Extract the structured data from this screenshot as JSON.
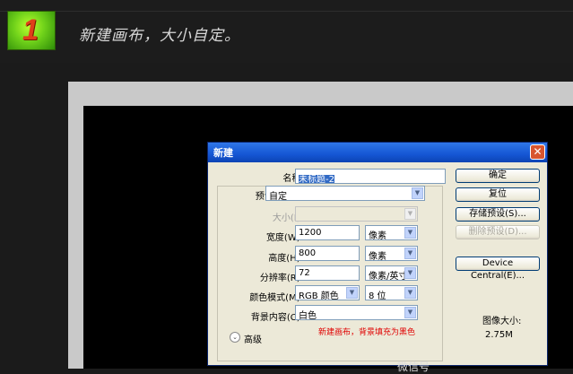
{
  "step": {
    "number": "1",
    "title": "新建画布，大小自定。"
  },
  "dialog": {
    "title": "新建",
    "close_glyph": "✕",
    "name_label": "名称(N):",
    "name_value": "未标题-2",
    "preset_label": "预设(P):",
    "preset_value": "自定",
    "size_label": "大小(I):",
    "width_label": "宽度(W):",
    "width_value": "1200",
    "width_unit": "像素",
    "height_label": "高度(H):",
    "height_value": "800",
    "height_unit": "像素",
    "resolution_label": "分辨率(R):",
    "resolution_value": "72",
    "resolution_unit": "像素/英寸",
    "colormode_label": "颜色模式(M):",
    "colormode_value": "RGB 颜色",
    "bitdepth_value": "8 位",
    "background_label": "背景内容(C):",
    "background_value": "白色",
    "advanced_label": "高级",
    "note": "新建画布，背景填充为黑色",
    "buttons": {
      "ok": "确定",
      "reset": "复位",
      "save_preset": "存储预设(S)...",
      "delete_preset": "删除预设(D)...",
      "device_central": "Device Central(E)..."
    },
    "image_size_label": "图像大小:",
    "image_size_value": "2.75M"
  },
  "watermark": "微信号"
}
